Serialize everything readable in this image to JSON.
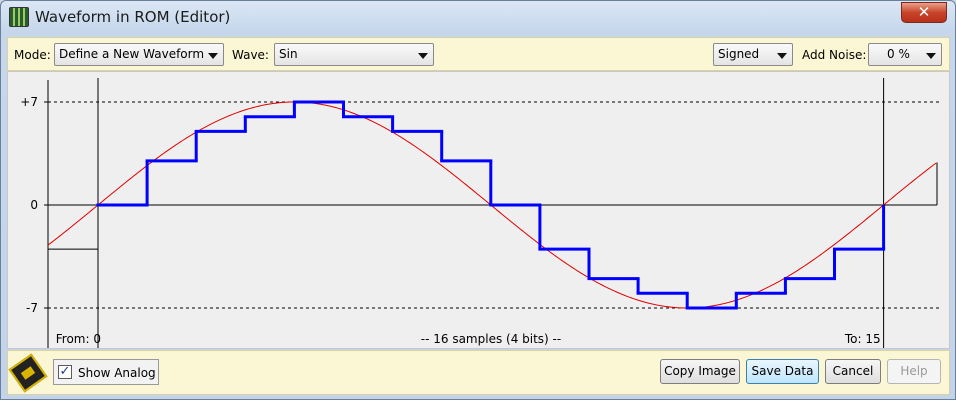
{
  "window": {
    "title": "Waveform in ROM (Editor)",
    "close_glyph": "✕"
  },
  "toolbar": {
    "mode_label": "Mode:",
    "mode_value": "Define a New Waveform",
    "wave_label": "Wave:",
    "wave_value": "Sin",
    "sign_value": "Signed",
    "noise_label": "Add Noise:",
    "noise_value": "0 %"
  },
  "chart_data": {
    "type": "line",
    "y_ticks": [
      "+7",
      "0",
      "-7"
    ],
    "ylim": [
      -7,
      7
    ],
    "x_start_label": "From: 0",
    "x_end_label": "To: 15",
    "caption": "-- 16 samples (4 bits) --",
    "samples": [
      0,
      3,
      5,
      6,
      7,
      6,
      5,
      3,
      0,
      -3,
      -5,
      -6,
      -7,
      -6,
      -5,
      -3
    ],
    "analog_amplitude": 7,
    "series": [
      {
        "name": "",
        "color": "#0000ff"
      },
      {
        "name": "",
        "color": "#e00000"
      }
    ],
    "grid": "dashed lines at +7 and -7"
  },
  "bottom": {
    "show_analog_label": "Show Analog",
    "show_analog_checked": true,
    "check_glyph": "✓",
    "copy_label": "Copy Image",
    "save_label": "Save Data",
    "cancel_label": "Cancel",
    "help_label": "Help"
  }
}
